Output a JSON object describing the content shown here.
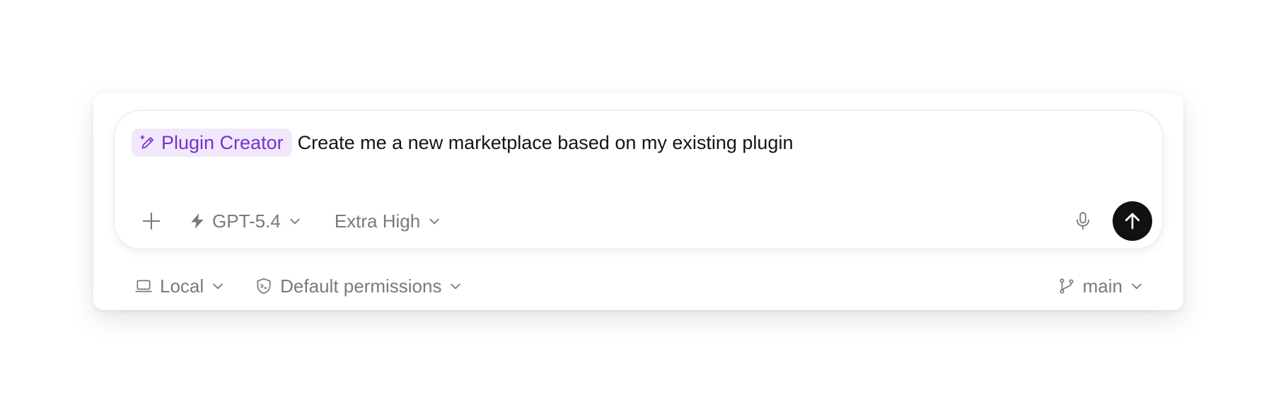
{
  "composer": {
    "skill_chip": {
      "label": "Plugin Creator",
      "icon": "pencil-sparkle-icon",
      "color": "#7a2fd0",
      "background": "#f1e9fb"
    },
    "prompt_text": "Create me a new marketplace based on my existing plugin"
  },
  "toolbar": {
    "add_icon": "plus-icon",
    "model": {
      "label": "GPT-5.4",
      "icon": "lightning-bolt-icon"
    },
    "reasoning": {
      "label": "Extra High"
    },
    "mic_icon": "microphone-icon",
    "send_icon": "arrow-up-icon",
    "send_color": "#111111"
  },
  "footer": {
    "environment": {
      "label": "Local",
      "icon": "laptop-icon"
    },
    "permissions": {
      "label": "Default permissions",
      "icon": "shield-terminal-icon"
    },
    "branch": {
      "label": "main",
      "icon": "git-branch-icon"
    }
  }
}
